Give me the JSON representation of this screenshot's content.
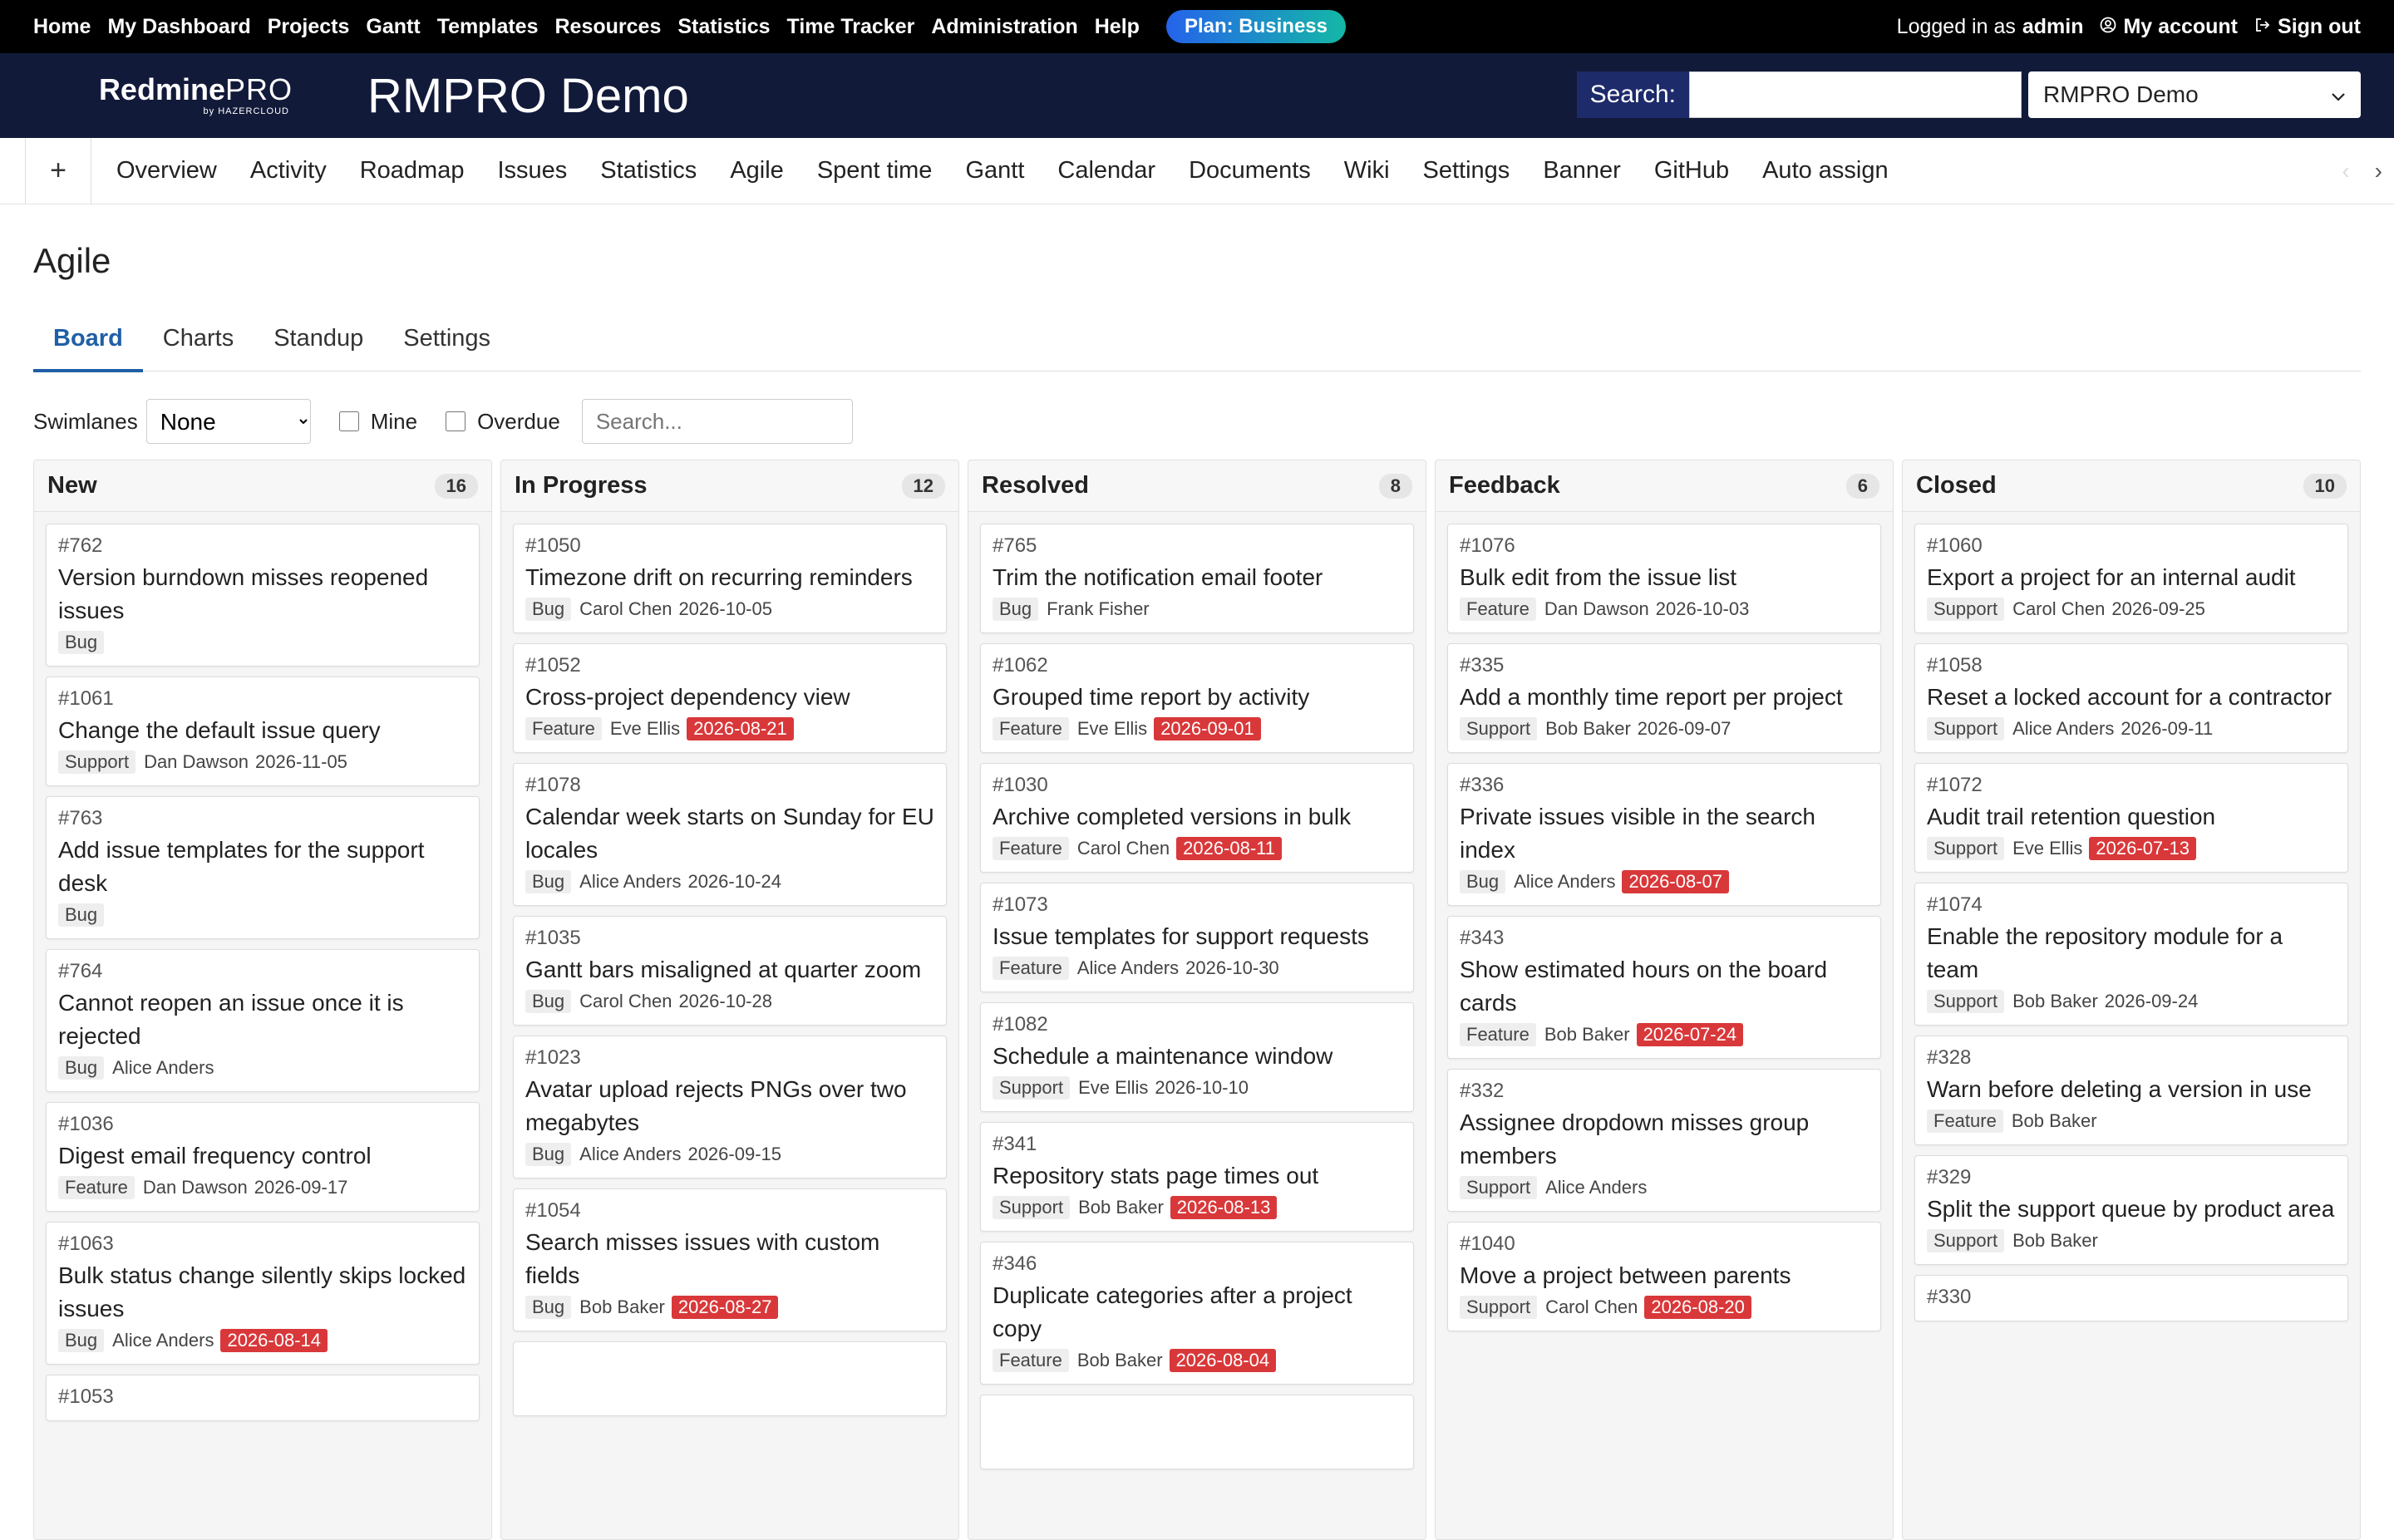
{
  "topnav": {
    "links": [
      "Home",
      "My Dashboard",
      "Projects",
      "Gantt",
      "Templates",
      "Resources",
      "Statistics",
      "Time Tracker",
      "Administration",
      "Help"
    ],
    "plan_badge": "Plan: Business",
    "logged_in_prefix": "Logged in as",
    "logged_in_user": "admin",
    "my_account": "My account",
    "sign_out": "Sign out"
  },
  "header": {
    "logo_main": "Redmine",
    "logo_pro": "PRO",
    "logo_sub": "by HAZERCLOUD",
    "project_title": "RMPRO Demo",
    "search_label": "Search:",
    "search_value": "",
    "project_select": "RMPRO Demo"
  },
  "mainmenu": {
    "plus": "+",
    "tabs": [
      "Overview",
      "Activity",
      "Roadmap",
      "Issues",
      "Statistics",
      "Agile",
      "Spent time",
      "Gantt",
      "Calendar",
      "Documents",
      "Wiki",
      "Settings",
      "Banner",
      "GitHub",
      "Auto assign"
    ]
  },
  "page": {
    "title": "Agile",
    "subtabs": [
      "Board",
      "Charts",
      "Standup",
      "Settings"
    ],
    "active_subtab": "Board"
  },
  "filters": {
    "swimlanes_label": "Swimlanes",
    "swimlanes_value": "None",
    "mine_label": "Mine",
    "overdue_label": "Overdue",
    "search_placeholder": "Search..."
  },
  "colors": {
    "topbar": "#000000",
    "header": "#121a3a",
    "accent": "#1f5fa6",
    "overdue": "#d9383a"
  },
  "columns": [
    {
      "name": "New",
      "count": "16",
      "cards": [
        {
          "id": "#762",
          "subject": "Version burndown misses reopened issues",
          "tracker": "Bug",
          "assignee": "",
          "due": "",
          "overdue": false
        },
        {
          "id": "#1061",
          "subject": "Change the default issue query",
          "tracker": "Support",
          "assignee": "Dan Dawson",
          "due": "2026-11-05",
          "overdue": false
        },
        {
          "id": "#763",
          "subject": "Add issue templates for the support desk",
          "tracker": "Bug",
          "assignee": "",
          "due": "",
          "overdue": false
        },
        {
          "id": "#764",
          "subject": "Cannot reopen an issue once it is rejected",
          "tracker": "Bug",
          "assignee": "Alice Anders",
          "due": "",
          "overdue": false
        },
        {
          "id": "#1036",
          "subject": "Digest email frequency control",
          "tracker": "Feature",
          "assignee": "Dan Dawson",
          "due": "2026-09-17",
          "overdue": false
        },
        {
          "id": "#1063",
          "subject": "Bulk status change silently skips locked issues",
          "tracker": "Bug",
          "assignee": "Alice Anders",
          "due": "2026-08-14",
          "overdue": true
        },
        {
          "id": "#1053",
          "subject": "",
          "tracker": "",
          "assignee": "",
          "due": "",
          "overdue": false
        }
      ]
    },
    {
      "name": "In Progress",
      "count": "12",
      "cards": [
        {
          "id": "#1050",
          "subject": "Timezone drift on recurring reminders",
          "tracker": "Bug",
          "assignee": "Carol Chen",
          "due": "2026-10-05",
          "overdue": false
        },
        {
          "id": "#1052",
          "subject": "Cross-project dependency view",
          "tracker": "Feature",
          "assignee": "Eve Ellis",
          "due": "2026-08-21",
          "overdue": true
        },
        {
          "id": "#1078",
          "subject": "Calendar week starts on Sunday for EU locales",
          "tracker": "Bug",
          "assignee": "Alice Anders",
          "due": "2026-10-24",
          "overdue": false
        },
        {
          "id": "#1035",
          "subject": "Gantt bars misaligned at quarter zoom",
          "tracker": "Bug",
          "assignee": "Carol Chen",
          "due": "2026-10-28",
          "overdue": false
        },
        {
          "id": "#1023",
          "subject": "Avatar upload rejects PNGs over two megabytes",
          "tracker": "Bug",
          "assignee": "Alice Anders",
          "due": "2026-09-15",
          "overdue": false
        },
        {
          "id": "#1054",
          "subject": "Search misses issues with custom fields",
          "tracker": "Bug",
          "assignee": "Bob Baker",
          "due": "2026-08-27",
          "overdue": true
        },
        {
          "id": "",
          "subject": "",
          "tracker": "",
          "assignee": "",
          "due": "",
          "overdue": false
        }
      ]
    },
    {
      "name": "Resolved",
      "count": "8",
      "cards": [
        {
          "id": "#765",
          "subject": "Trim the notification email footer",
          "tracker": "Bug",
          "assignee": "Frank Fisher",
          "due": "",
          "overdue": false
        },
        {
          "id": "#1062",
          "subject": "Grouped time report by activity",
          "tracker": "Feature",
          "assignee": "Eve Ellis",
          "due": "2026-09-01",
          "overdue": true
        },
        {
          "id": "#1030",
          "subject": "Archive completed versions in bulk",
          "tracker": "Feature",
          "assignee": "Carol Chen",
          "due": "2026-08-11",
          "overdue": true
        },
        {
          "id": "#1073",
          "subject": "Issue templates for support requests",
          "tracker": "Feature",
          "assignee": "Alice Anders",
          "due": "2026-10-30",
          "overdue": false
        },
        {
          "id": "#1082",
          "subject": "Schedule a maintenance window",
          "tracker": "Support",
          "assignee": "Eve Ellis",
          "due": "2026-10-10",
          "overdue": false
        },
        {
          "id": "#341",
          "subject": "Repository stats page times out",
          "tracker": "Support",
          "assignee": "Bob Baker",
          "due": "2026-08-13",
          "overdue": true
        },
        {
          "id": "#346",
          "subject": "Duplicate categories after a project copy",
          "tracker": "Feature",
          "assignee": "Bob Baker",
          "due": "2026-08-04",
          "overdue": true
        },
        {
          "id": "",
          "subject": "",
          "tracker": "",
          "assignee": "",
          "due": "",
          "overdue": false
        }
      ]
    },
    {
      "name": "Feedback",
      "count": "6",
      "cards": [
        {
          "id": "#1076",
          "subject": "Bulk edit from the issue list",
          "tracker": "Feature",
          "assignee": "Dan Dawson",
          "due": "2026-10-03",
          "overdue": false
        },
        {
          "id": "#335",
          "subject": "Add a monthly time report per project",
          "tracker": "Support",
          "assignee": "Bob Baker",
          "due": "2026-09-07",
          "overdue": false
        },
        {
          "id": "#336",
          "subject": "Private issues visible in the search index",
          "tracker": "Bug",
          "assignee": "Alice Anders",
          "due": "2026-08-07",
          "overdue": true
        },
        {
          "id": "#343",
          "subject": "Show estimated hours on the board cards",
          "tracker": "Feature",
          "assignee": "Bob Baker",
          "due": "2026-07-24",
          "overdue": true
        },
        {
          "id": "#332",
          "subject": "Assignee dropdown misses group members",
          "tracker": "Support",
          "assignee": "Alice Anders",
          "due": "",
          "overdue": false
        },
        {
          "id": "#1040",
          "subject": "Move a project between parents",
          "tracker": "Support",
          "assignee": "Carol Chen",
          "due": "2026-08-20",
          "overdue": true
        }
      ]
    },
    {
      "name": "Closed",
      "count": "10",
      "cards": [
        {
          "id": "#1060",
          "subject": "Export a project for an internal audit",
          "tracker": "Support",
          "assignee": "Carol Chen",
          "due": "2026-09-25",
          "overdue": false
        },
        {
          "id": "#1058",
          "subject": "Reset a locked account for a contractor",
          "tracker": "Support",
          "assignee": "Alice Anders",
          "due": "2026-09-11",
          "overdue": false
        },
        {
          "id": "#1072",
          "subject": "Audit trail retention question",
          "tracker": "Support",
          "assignee": "Eve Ellis",
          "due": "2026-07-13",
          "overdue": true
        },
        {
          "id": "#1074",
          "subject": "Enable the repository module for a team",
          "tracker": "Support",
          "assignee": "Bob Baker",
          "due": "2026-09-24",
          "overdue": false
        },
        {
          "id": "#328",
          "subject": "Warn before deleting a version in use",
          "tracker": "Feature",
          "assignee": "Bob Baker",
          "due": "",
          "overdue": false
        },
        {
          "id": "#329",
          "subject": "Split the support queue by product area",
          "tracker": "Support",
          "assignee": "Bob Baker",
          "due": "",
          "overdue": false
        },
        {
          "id": "#330",
          "subject": "",
          "tracker": "",
          "assignee": "",
          "due": "",
          "overdue": false
        }
      ]
    }
  ]
}
